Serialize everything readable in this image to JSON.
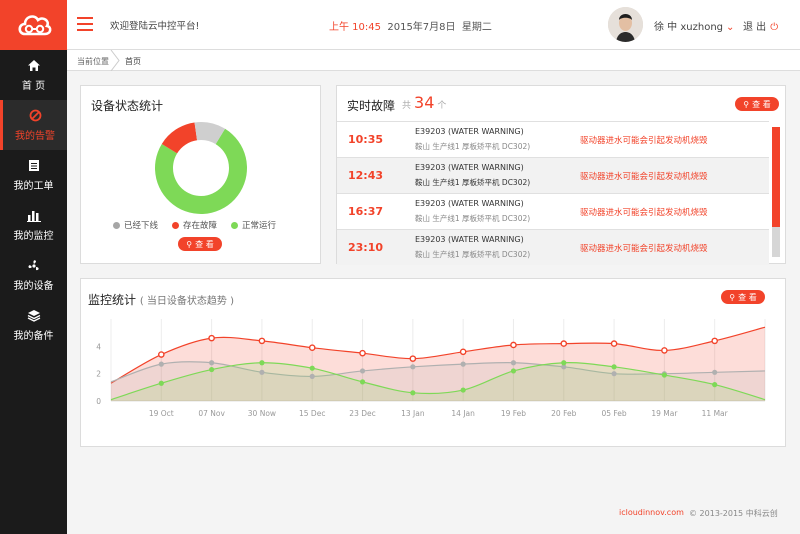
{
  "colors": {
    "accent": "#f2432a",
    "sidebar": "#1b1b1b",
    "green": "#7ed957",
    "gray": "#cfcfcf"
  },
  "logo_icon": "cloud-network-icon",
  "sidebar": {
    "items": [
      {
        "label": "首 页",
        "icon": "home-icon",
        "active": false
      },
      {
        "label": "我的告警",
        "icon": "alert-icon",
        "active": true
      },
      {
        "label": "我的工单",
        "icon": "worksheet-icon",
        "active": false
      },
      {
        "label": "我的监控",
        "icon": "bar-chart-icon",
        "active": false
      },
      {
        "label": "我的设备",
        "icon": "fan-icon",
        "active": false
      },
      {
        "label": "我的备件",
        "icon": "layers-icon",
        "active": false
      }
    ]
  },
  "header": {
    "welcome": "欢迎登陆云中控平台!",
    "time": "上午 10:45",
    "date": "2015年7月8日",
    "weekday": "星期二",
    "username": "徐 中 xuzhong",
    "logout": "退 出"
  },
  "breadcrumb": {
    "home": "当前位置",
    "current": "首页"
  },
  "device_stats": {
    "title": "设备状态统计",
    "legend": [
      {
        "label": "已经下线",
        "color": "#a6a6a6"
      },
      {
        "label": "存在故障",
        "color": "#f2432a"
      },
      {
        "label": "正常运行",
        "color": "#7ed957"
      }
    ],
    "view_button": "查 看"
  },
  "chart_data": [
    {
      "type": "pie",
      "title": "设备状态统计",
      "slices": [
        {
          "label": "正常运行",
          "value": 0.75,
          "color": "#7ed957"
        },
        {
          "label": "存在故障",
          "value": 0.14,
          "color": "#f2432a"
        },
        {
          "label": "已经下线",
          "value": 0.11,
          "color": "#cfcfcf"
        }
      ],
      "donut": true,
      "legend": "bottom"
    },
    {
      "type": "area",
      "title": "监控统计",
      "subtitle": "当日设备状态趋势",
      "x": [
        "19 Oct",
        "07 Nov",
        "30 Now",
        "15 Dec",
        "23 Dec",
        "13 Jan",
        "14 Jan",
        "19 Feb",
        "20 Feb",
        "05 Feb",
        "19 Mar",
        "11 Mar"
      ],
      "ylim": [
        0,
        6
      ],
      "yticks": [
        0,
        2,
        4
      ],
      "grid": true,
      "series": [
        {
          "color": "#f2432a",
          "values": [
            1.3,
            3.4,
            4.6,
            4.4,
            3.9,
            3.5,
            3.1,
            3.6,
            4.1,
            4.2,
            4.2,
            3.7,
            4.4,
            5.4
          ]
        },
        {
          "color": "#b0b0b0",
          "values": [
            1.4,
            2.7,
            2.8,
            2.1,
            1.8,
            2.2,
            2.5,
            2.7,
            2.8,
            2.5,
            2.0,
            2.0,
            2.1,
            2.2
          ]
        },
        {
          "color": "#7ed957",
          "values": [
            0.1,
            1.3,
            2.3,
            2.8,
            2.4,
            1.4,
            0.6,
            0.8,
            2.2,
            2.8,
            2.5,
            1.9,
            1.2,
            0.1
          ]
        }
      ]
    }
  ],
  "faults": {
    "title": "实时故障",
    "count_prefix": "共",
    "count": "34",
    "count_suffix": "个",
    "view_button": "查 看",
    "rows": [
      {
        "time": "10:35",
        "code": "E39203 (WATER WARNING)",
        "location": "鞍山  生产线1  厚板矫平机 DC302)",
        "message": "驱动器进水可能会引起发动机烧毁"
      },
      {
        "time": "12:43",
        "code": "E39203 (WATER WARNING)",
        "location": "鞍山  生产线1  厚板矫平机 DC302)",
        "message": "驱动器进水可能会引起发动机烧毁"
      },
      {
        "time": "16:37",
        "code": "E39203 (WATER WARNING)",
        "location": "鞍山  生产线1  厚板矫平机 DC302)",
        "message": "驱动器进水可能会引起发动机烧毁"
      },
      {
        "time": "23:10",
        "code": "E39203 (WATER WARNING)",
        "location": "鞍山  生产线1  厚板矫平机 DC302)",
        "message": "驱动器进水可能会引起发动机烧毁"
      }
    ]
  },
  "monitor": {
    "title": "监控统计",
    "subtitle": "( 当日设备状态趋势 )",
    "view_button": "查 看"
  },
  "footer": {
    "link": "icloudinnov.com",
    "copyright": "© 2013-2015 中科云创"
  }
}
